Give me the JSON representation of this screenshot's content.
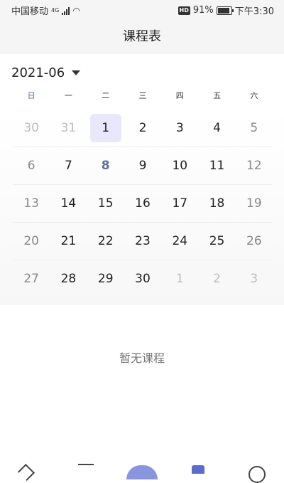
{
  "status_bar": {
    "carrier": "中国移动",
    "network": "4G",
    "hd": "HD",
    "battery": "91%",
    "battery_level": 0.91,
    "time": "下午3:30"
  },
  "header": {
    "title": "课程表"
  },
  "month_picker": {
    "label": "2021-06"
  },
  "weekdays": [
    "日",
    "一",
    "二",
    "三",
    "四",
    "五",
    "六"
  ],
  "calendar": {
    "weeks": [
      [
        "30",
        "31",
        "1",
        "2",
        "3",
        "4",
        "5"
      ],
      [
        "6",
        "7",
        "8",
        "9",
        "10",
        "11",
        "12"
      ],
      [
        "13",
        "14",
        "15",
        "16",
        "17",
        "18",
        "19"
      ],
      [
        "20",
        "21",
        "22",
        "23",
        "24",
        "25",
        "26"
      ],
      [
        "27",
        "28",
        "29",
        "30",
        "1",
        "2",
        "3"
      ]
    ],
    "selected": "1",
    "today": "8"
  },
  "empty_state": {
    "text": "暂无课程"
  },
  "tab_bar": {
    "icons": [
      "home-icon",
      "book-icon",
      "center-action-icon",
      "calendar-icon",
      "profile-icon"
    ],
    "active_color": "#5b6bd0"
  },
  "colors": {
    "accent": "#5a6f9a",
    "selected_bg": "#e9e7fb"
  }
}
